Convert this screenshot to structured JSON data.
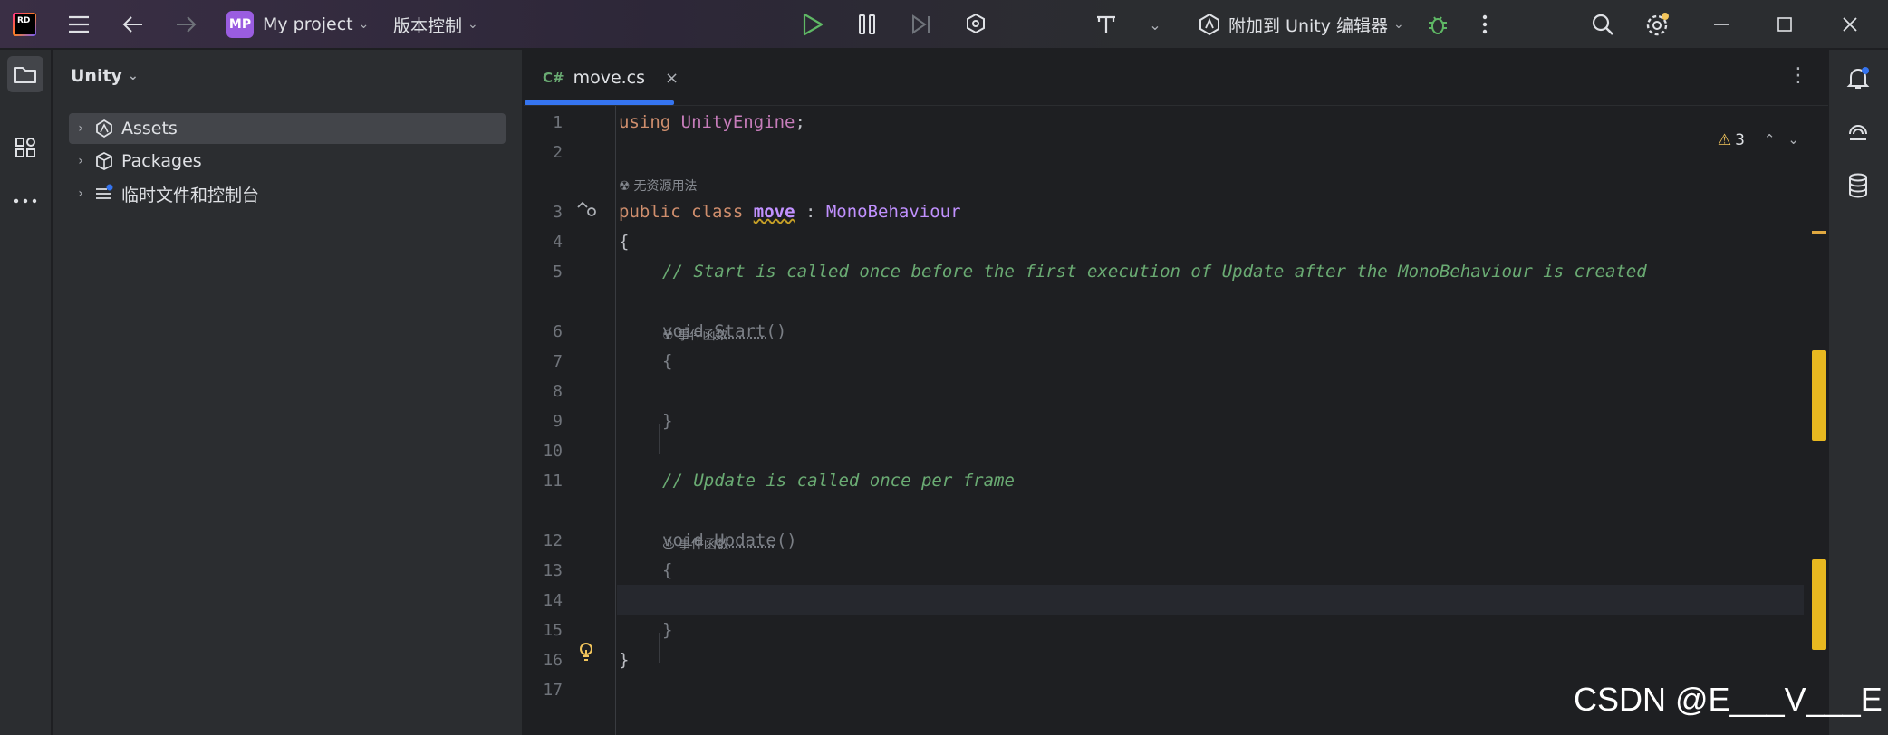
{
  "titlebar": {
    "project_initials": "MP",
    "project_name": "My project",
    "vcs_label": "版本控制",
    "attach_label": "附加到 Unity 编辑器"
  },
  "project_panel": {
    "title": "Unity",
    "items": [
      {
        "label": "Assets"
      },
      {
        "label": "Packages"
      },
      {
        "label": "临时文件和控制台"
      }
    ]
  },
  "editor": {
    "tab": {
      "lang": "C#",
      "file": "move.cs",
      "close": "×"
    },
    "warnings_count": "3",
    "line_numbers": [
      "1",
      "2",
      "3",
      "4",
      "5",
      "6",
      "7",
      "8",
      "9",
      "10",
      "11",
      "12",
      "13",
      "14",
      "15",
      "16",
      "17"
    ],
    "code": {
      "l1_kw": "using",
      "l1_ns": "UnityEngine",
      "l1_semi": ";",
      "hint_usage": "无资源用法",
      "l3_public": "public",
      "l3_class": "class",
      "l3_name": "move",
      "l3_colon": " : ",
      "l3_base": "MonoBehaviour",
      "l4_brace": "{",
      "l5_comment": "// Start is called once before the first execution of Update after the MonoBehaviour is created",
      "hint_event1": "事件函数",
      "l6_void": "void",
      "l6_name": "Start",
      "l6_parens": "()",
      "l7_brace": "{",
      "l9_brace": "}",
      "l11_comment": "// Update is called once per frame",
      "hint_event2": "事件函数",
      "l12_void": "void",
      "l12_name": "Update",
      "l12_parens": "()",
      "l13_brace": "{",
      "l15_brace": "}",
      "l16_brace": "}"
    }
  },
  "watermark": "CSDN @E___V___E",
  "colors": {
    "accent": "#3574f0",
    "warning": "#f2c55c",
    "keyword": "#cf8e6d",
    "comment": "#6aab73",
    "type": "#c77dbb"
  }
}
